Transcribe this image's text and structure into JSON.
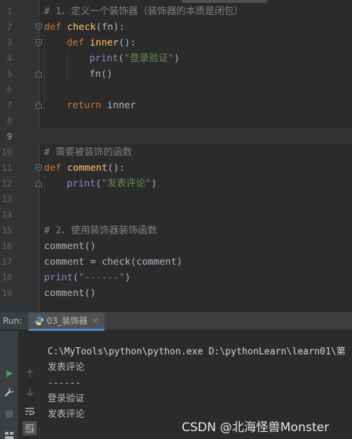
{
  "editor": {
    "lines": [
      {
        "n": "1",
        "comment": "# 1、定义一个装饰器（装饰器的本质是闭包）"
      },
      {
        "n": "2",
        "kw": "def",
        "name": "check",
        "rest": "(fn):"
      },
      {
        "n": "3",
        "kw": "def",
        "name": "inner",
        "rest": "():"
      },
      {
        "n": "4",
        "builtin": "print",
        "open": "(",
        "str": "\"登录验证\"",
        "close": ")"
      },
      {
        "n": "5",
        "text": "fn()"
      },
      {
        "n": "6"
      },
      {
        "n": "7",
        "kw": "return",
        "text": " inner"
      },
      {
        "n": "8"
      },
      {
        "n": "9"
      },
      {
        "n": "10",
        "comment": "# 需要被装饰的函数"
      },
      {
        "n": "11",
        "kw": "def",
        "name": "comment",
        "rest": "():"
      },
      {
        "n": "12",
        "builtin": "print",
        "open": "(",
        "str": "\"发表评论\"",
        "close": ")"
      },
      {
        "n": "13"
      },
      {
        "n": "14"
      },
      {
        "n": "15",
        "comment": "# 2、使用装饰器装饰函数"
      },
      {
        "n": "16",
        "text": "comment()"
      },
      {
        "n": "17",
        "text": "comment = check(comment)"
      },
      {
        "n": "18",
        "builtin": "print",
        "open": "(",
        "str": "\"------\"",
        "close": ")"
      },
      {
        "n": "19",
        "text": "comment()"
      }
    ]
  },
  "run": {
    "label": "Run:",
    "tab_label": "03_装饰器",
    "tab_close": "×",
    "output": [
      "C:\\MyTools\\python\\python.exe D:\\pythonLearn\\learn01\\第",
      "发表评论",
      "------",
      "登录验证",
      "发表评论"
    ]
  },
  "watermark": "CSDN @北海怪兽Monster",
  "colors": {
    "keyword": "#cc7832",
    "function": "#ffc66d",
    "builtin": "#8888c6",
    "string": "#6a8759",
    "comment": "#808080",
    "text": "#a9b7c6",
    "run_icon": "#499c54",
    "tab_underline": "#4a88c7"
  }
}
